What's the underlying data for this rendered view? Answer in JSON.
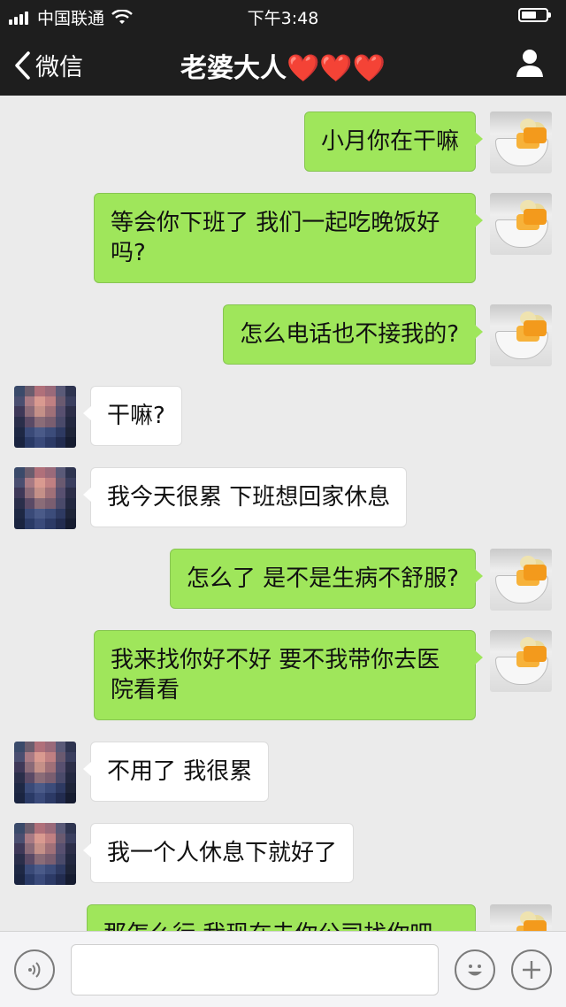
{
  "status_bar": {
    "carrier": "中国联通",
    "time": "下午3:48",
    "icons": [
      "signal-icon",
      "wifi-icon",
      "battery-icon"
    ]
  },
  "nav": {
    "back_label": "微信",
    "title_text": "老婆大人",
    "title_hearts": "❤️❤️❤️",
    "icons": [
      "back-chevron-icon",
      "profile-icon"
    ]
  },
  "messages": [
    {
      "sender": "me",
      "text": "小月你在干嘛"
    },
    {
      "sender": "me",
      "text": "等会你下班了 我们一起吃晚饭好吗?"
    },
    {
      "sender": "me",
      "text": "怎么电话也不接我的?"
    },
    {
      "sender": "other",
      "text": "干嘛?"
    },
    {
      "sender": "other",
      "text": "我今天很累 下班想回家休息"
    },
    {
      "sender": "me",
      "text": "怎么了 是不是生病不舒服?"
    },
    {
      "sender": "me",
      "text": "我来找你好不好 要不我带你去医院看看"
    },
    {
      "sender": "other",
      "text": "不用了 我很累"
    },
    {
      "sender": "other",
      "text": "我一个人休息下就好了"
    },
    {
      "sender": "me",
      "text": "那怎么行 我现在去你公司找你吧"
    }
  ],
  "input_bar": {
    "value": "",
    "icons": [
      "voice-icon",
      "emoji-icon",
      "plus-icon"
    ]
  },
  "colors": {
    "bar_bg": "#1e1e1e",
    "chat_bg": "#ebebeb",
    "my_bubble": "#9fe65b",
    "other_bubble": "#ffffff",
    "heart": "#e0242a"
  }
}
